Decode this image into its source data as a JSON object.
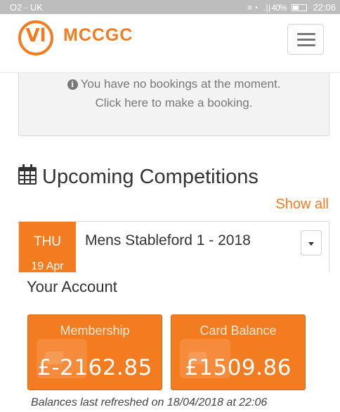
{
  "status_bar": {
    "carrier": "O2 - UK",
    "signal_icons": "≡ ◔",
    "signal_label": ".∣| 40%",
    "time": "22:06"
  },
  "header": {
    "logo_letters": "Vl",
    "brand": "MCCGC",
    "menu_icon": "hamburger-icon"
  },
  "bookings": {
    "info_icon": "i",
    "message_line1": "You have no bookings at the moment.",
    "message_line2": "Click here to make a booking."
  },
  "competitions": {
    "title": "Upcoming Competitions",
    "show_all": "Show all",
    "items": [
      {
        "day_of_week": "THU",
        "date": "19 Apr",
        "name": "Mens Stableford 1 - 2018"
      }
    ]
  },
  "account": {
    "title": "Your Account",
    "tiles": [
      {
        "label": "Membership",
        "value": "£-2162.85"
      },
      {
        "label": "Card Balance",
        "value": "£1509.86"
      }
    ],
    "refresh_note": "Balances last refreshed on 18/04/2018 at 22:06"
  },
  "colors": {
    "accent": "#f47c20",
    "panel": "#f3f3f3",
    "status_bar": "#bdbdbd"
  }
}
